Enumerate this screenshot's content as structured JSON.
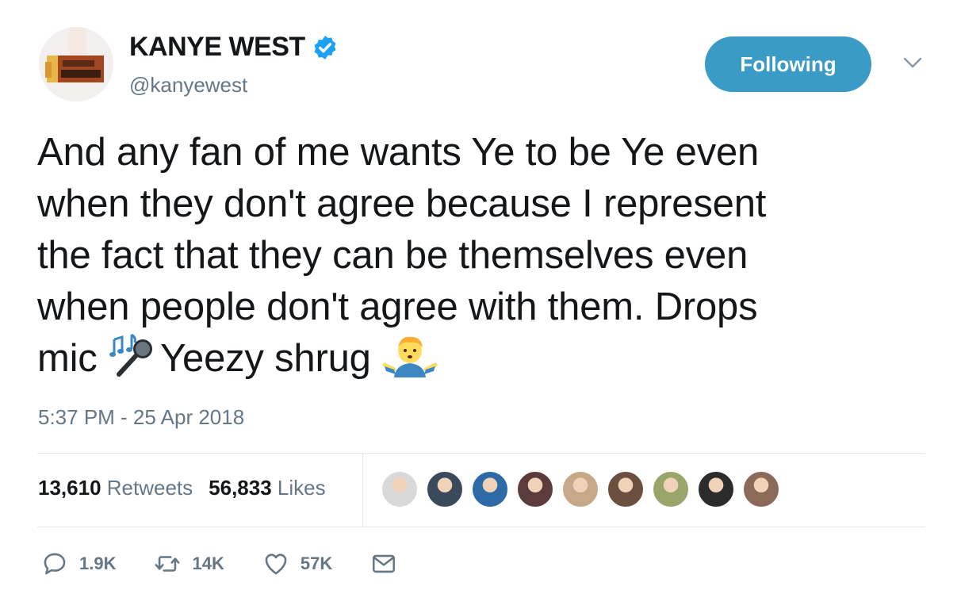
{
  "user": {
    "name": "KANYE WEST",
    "handle": "@kanyewest",
    "verified": true,
    "verified_color": "#1da1f2"
  },
  "follow_button": {
    "label": "Following",
    "color": "#3b9bc7"
  },
  "tweet": {
    "text_lines": [
      "And any fan of me wants Ye to be Ye even",
      "when they don't agree because I represent",
      "the fact that they can be themselves even",
      "when people don't agree with them. Drops"
    ],
    "last_line_start": "mic ",
    "last_line_middle": "Yeezy shrug ",
    "emoji": [
      "microphone-emoji",
      "shrug-emoji"
    ],
    "timestamp": "5:37 PM - 25 Apr 2018"
  },
  "stats": {
    "retweets_count": "13,610",
    "retweets_label": "Retweets",
    "likes_count": "56,833",
    "likes_label": "Likes"
  },
  "likers": [
    {
      "color": "#d9d9d9"
    },
    {
      "color": "#3a4a5c"
    },
    {
      "color": "#2e6aa6"
    },
    {
      "color": "#5b3b3b"
    },
    {
      "color": "#c7a98a"
    },
    {
      "color": "#6b5040"
    },
    {
      "color": "#9aa56c"
    },
    {
      "color": "#2c2c2c"
    },
    {
      "color": "#8b6a5a"
    }
  ],
  "actions": {
    "reply_count": "1.9K",
    "retweet_count": "14K",
    "like_count": "57K"
  }
}
